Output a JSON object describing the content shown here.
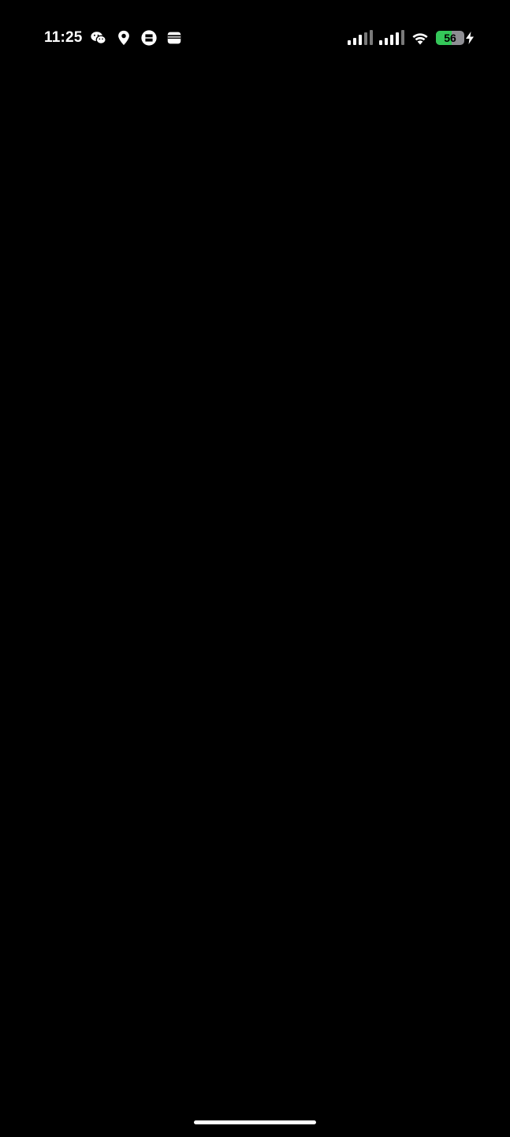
{
  "status_bar": {
    "time": "11:25",
    "left_icons": [
      "wechat-icon",
      "location-pin-icon",
      "amex-icon",
      "wallet-icon"
    ],
    "right_icons": [
      "cellular-signal-icon",
      "cellular-signal-icon",
      "wifi-icon",
      "battery-icon",
      "charging-bolt-icon"
    ],
    "battery_level": "56",
    "battery_fraction": 0.56,
    "battery_color": "#34c759"
  },
  "background_color": "#000000"
}
